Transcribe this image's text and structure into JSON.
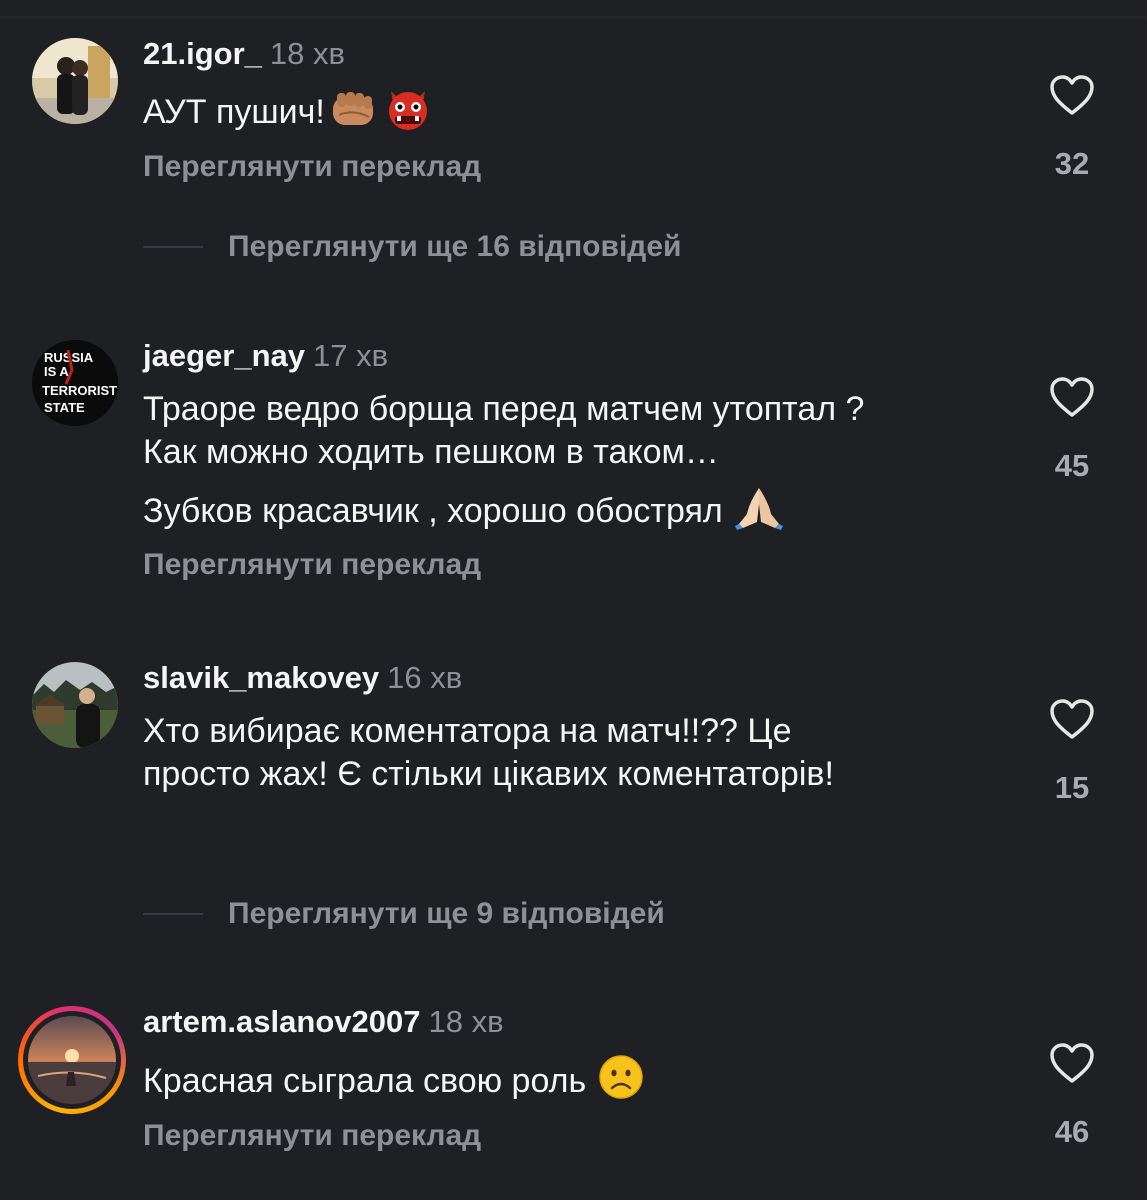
{
  "comments": [
    {
      "username": "21.igor_",
      "time": "18 хв",
      "lines": [
        "АУТ пушич!"
      ],
      "emojis": [
        "fist-emoji",
        "ogre-emoji"
      ],
      "translate": "Переглянути переклад",
      "likes": "32",
      "avatar": "photo-couple"
    },
    {
      "username": "jaeger_nay",
      "time": "17 хв",
      "lines": [
        "Траоре ведро борща перед матчем утоптал ?",
        "Как можно ходить пешком в таком…",
        "Зубков красавчик , хорошо обострял"
      ],
      "emojis": [
        "praying-hands-emoji"
      ],
      "translate": "Переглянути переклад",
      "likes": "45",
      "avatar_text": [
        "RUSSIA",
        "IS A",
        "TERRORIST",
        "STATE"
      ]
    },
    {
      "username": "slavik_makovey",
      "time": "16 хв",
      "lines": [
        "Хто вибирає коментатора на матч!!?? Це",
        "просто жах! Є стільки цікавих коментаторів!"
      ],
      "likes": "15",
      "avatar": "photo-man-outdoors"
    },
    {
      "username": "artem.aslanov2007",
      "time": "18 хв",
      "lines": [
        "Красная сыграла свою роль"
      ],
      "emojis": [
        "frowning-face-emoji"
      ],
      "translate": "Переглянути переклад",
      "likes": "46",
      "avatar": "photo-sunset"
    }
  ],
  "replies": [
    {
      "label": "Переглянути ще 16 відповідей"
    },
    {
      "label": "Переглянути ще 9 відповідей"
    }
  ],
  "colors": {
    "background": "#1f2024",
    "text": "#f5f5f5",
    "muted": "#8e9096",
    "story_ring": [
      "#ffb300",
      "#e1306c",
      "#c13584"
    ]
  },
  "icons": {
    "like": "heart-outline-icon"
  }
}
